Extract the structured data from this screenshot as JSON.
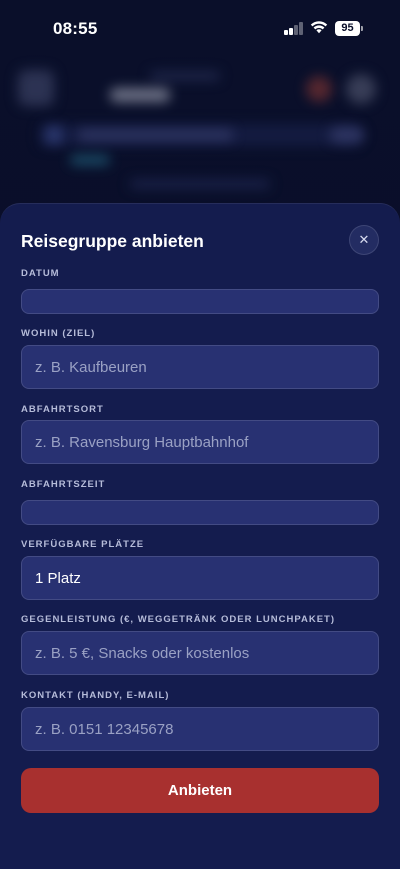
{
  "status_bar": {
    "time": "08:55",
    "battery": "95"
  },
  "sheet": {
    "title": "Reisegruppe anbieten",
    "close_icon": "close-icon",
    "fields": [
      {
        "label": "DATUM",
        "value": "",
        "placeholder": ""
      },
      {
        "label": "WOHIN (ZIEL)",
        "value": "",
        "placeholder": "z. B. Kaufbeuren"
      },
      {
        "label": "ABFAHRTSORT",
        "value": "",
        "placeholder": "z. B. Ravensburg Hauptbahnhof"
      },
      {
        "label": "ABFAHRTSZEIT",
        "value": "",
        "placeholder": ""
      },
      {
        "label": "VERFÜGBARE PLÄTZE",
        "value": "1 Platz",
        "placeholder": ""
      },
      {
        "label": "GEGENLEISTUNG (€, WEGGETRÄNK ODER LUNCHPAKET)",
        "value": "",
        "placeholder": "z. B. 5 €, Snacks oder kostenlos"
      },
      {
        "label": "KONTAKT (HANDY, E-MAIL)",
        "value": "",
        "placeholder": "z. B. 0151 12345678"
      }
    ],
    "submit_label": "Anbieten"
  },
  "colors": {
    "sheet_bg": "#141c4e",
    "field_bg": "#283172",
    "submit_bg": "#a8302f"
  }
}
